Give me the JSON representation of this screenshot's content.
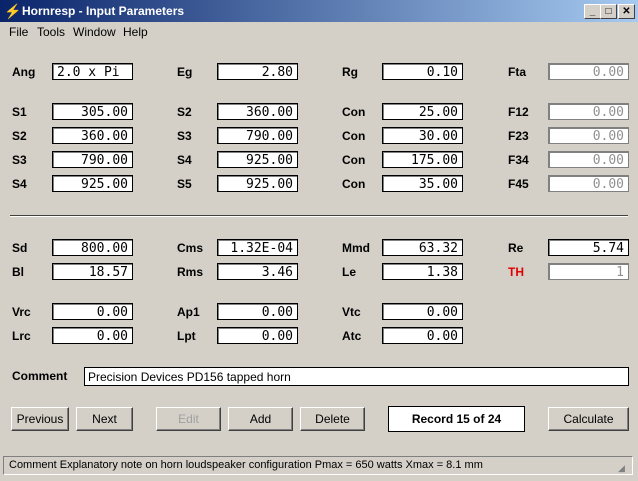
{
  "window": {
    "title": "Hornresp - Input Parameters",
    "minimize_icon": "minimize-icon",
    "maximize_icon": "maximize-icon",
    "close_icon": "close-icon"
  },
  "menu": [
    "File",
    "Tools",
    "Window",
    "Help"
  ],
  "fields": {
    "Ang": {
      "label": "Ang",
      "value": "2.0 x Pi"
    },
    "Eg": {
      "label": "Eg",
      "value": "2.80"
    },
    "Rg": {
      "label": "Rg",
      "value": "0.10"
    },
    "Fta": {
      "label": "Fta",
      "value": "0.00"
    },
    "S1": {
      "label": "S1",
      "value": "305.00"
    },
    "S2a": {
      "label": "S2",
      "value": "360.00"
    },
    "Con1": {
      "label": "Con",
      "value": "25.00"
    },
    "F12": {
      "label": "F12",
      "value": "0.00"
    },
    "S2b": {
      "label": "S2",
      "value": "360.00"
    },
    "S3a": {
      "label": "S3",
      "value": "790.00"
    },
    "Con2": {
      "label": "Con",
      "value": "30.00"
    },
    "F23": {
      "label": "F23",
      "value": "0.00"
    },
    "S3b": {
      "label": "S3",
      "value": "790.00"
    },
    "S4a": {
      "label": "S4",
      "value": "925.00"
    },
    "Con3": {
      "label": "Con",
      "value": "175.00"
    },
    "F34": {
      "label": "F34",
      "value": "0.00"
    },
    "S4b": {
      "label": "S4",
      "value": "925.00"
    },
    "S5": {
      "label": "S5",
      "value": "925.00"
    },
    "Con4": {
      "label": "Con",
      "value": "35.00"
    },
    "F45": {
      "label": "F45",
      "value": "0.00"
    },
    "Sd": {
      "label": "Sd",
      "value": "800.00"
    },
    "Cms": {
      "label": "Cms",
      "value": "1.32E-04"
    },
    "Mmd": {
      "label": "Mmd",
      "value": "63.32"
    },
    "Re": {
      "label": "Re",
      "value": "5.74"
    },
    "Bl": {
      "label": "Bl",
      "value": "18.57"
    },
    "Rms": {
      "label": "Rms",
      "value": "3.46"
    },
    "Le": {
      "label": "Le",
      "value": "1.38"
    },
    "TH": {
      "label": "TH",
      "value": "1"
    },
    "Vrc": {
      "label": "Vrc",
      "value": "0.00"
    },
    "Ap1": {
      "label": "Ap1",
      "value": "0.00"
    },
    "Vtc": {
      "label": "Vtc",
      "value": "0.00"
    },
    "Lrc": {
      "label": "Lrc",
      "value": "0.00"
    },
    "Lpt": {
      "label": "Lpt",
      "value": "0.00"
    },
    "Atc": {
      "label": "Atc",
      "value": "0.00"
    }
  },
  "comment": {
    "label": "Comment",
    "value": "Precision Devices PD156 tapped horn"
  },
  "buttons": {
    "previous": "Previous",
    "next": "Next",
    "edit": "Edit",
    "add": "Add",
    "delete": "Delete",
    "calculate": "Calculate"
  },
  "record": "Record 15 of 24",
  "status": "Comment   Explanatory note on horn loudspeaker configuration   Pmax = 650 watts   Xmax = 8.1 mm",
  "colors": {
    "title_start": "#0a246a",
    "title_end": "#a6caf0",
    "th_label": "#e00000"
  }
}
